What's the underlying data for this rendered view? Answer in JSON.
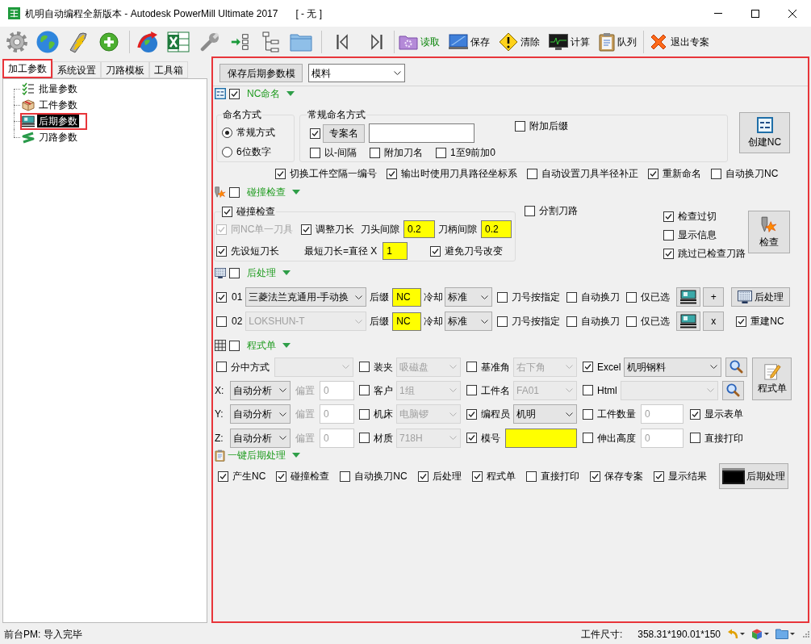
{
  "window": {
    "title": "机明自动编程全新版本 - Autodesk PowerMill Ultimate 2017",
    "document": "[ - 无 ]"
  },
  "toolbar": {
    "buttons": [
      {
        "label": "读取",
        "highlighted": true
      },
      {
        "label": "保存",
        "highlighted": false
      },
      {
        "label": "清除",
        "highlighted": false
      },
      {
        "label": "计算",
        "highlighted": false
      },
      {
        "label": "队列",
        "highlighted": false
      },
      {
        "label": "退出专案",
        "highlighted": false
      }
    ]
  },
  "left_tabs": [
    {
      "label": "加工参数",
      "selected": true,
      "highlighted": true
    },
    {
      "label": "系统设置",
      "selected": false,
      "highlighted": false
    },
    {
      "label": "刀路模板",
      "selected": false,
      "highlighted": false
    },
    {
      "label": "工具箱",
      "selected": false,
      "highlighted": false
    }
  ],
  "tree": [
    {
      "label": "批量参数",
      "selected": false,
      "highlighted": false
    },
    {
      "label": "工件参数",
      "selected": false,
      "highlighted": false
    },
    {
      "label": "后期参数",
      "selected": true,
      "highlighted": true
    },
    {
      "label": "刀路参数",
      "selected": false,
      "highlighted": false
    }
  ],
  "post_panel": {
    "highlighted": true,
    "template_button": "保存后期参数模",
    "template": "模料",
    "nc_naming": {
      "title": "NC命名",
      "checked": true,
      "expanded": true,
      "mode": {
        "title": "命名方式",
        "options": [
          {
            "label": "常规方式",
            "selected": true
          },
          {
            "label": "6位数字",
            "selected": false
          }
        ]
      },
      "regular": {
        "title": "常规命名方式",
        "project_name": {
          "checked": true,
          "button": "专案名"
        },
        "suffix": {
          "label": "附加后缀",
          "checked": false
        },
        "options": [
          {
            "label": "以-间隔",
            "checked": false
          },
          {
            "label": "附加刀名",
            "checked": false
          },
          {
            "label": "1至9前加0",
            "checked": false
          }
        ]
      },
      "create_button": "创建NC",
      "options": [
        {
          "label": "切换工件空隔一编号",
          "checked": true
        },
        {
          "label": "输出时使用刀具路径坐标系",
          "checked": true
        },
        {
          "label": "自动设置刀具半径补正",
          "checked": false
        },
        {
          "label": "重新命名",
          "checked": true
        },
        {
          "label": "自动换刀NC",
          "checked": false
        }
      ]
    },
    "collision": {
      "title": "碰撞检查",
      "checked": false,
      "expanded": true,
      "group": {
        "label": "碰撞检查",
        "checked": true,
        "same_tool": {
          "label": "同NC单一刀具",
          "checked": true,
          "disabled": true
        },
        "adjust_length": {
          "label": "调整刀长",
          "checked": true,
          "disabled": false
        },
        "tip_gap": {
          "label": "刀头间隙",
          "value": "0.2",
          "highlighted": true
        },
        "holder_gap": {
          "label": "刀柄间隙",
          "value": "0.2",
          "highlighted": true
        },
        "short_first": {
          "label": "先设短刀长",
          "checked": true,
          "disabled": false
        },
        "min_length": {
          "label": "最短刀长=直径 X",
          "value": "1",
          "highlighted": true
        },
        "keep_numbers": {
          "label": "避免刀号改变",
          "checked": true,
          "disabled": false
        }
      },
      "split": {
        "label": "分割刀路",
        "checked": false
      },
      "checks": [
        {
          "label": "检查过切",
          "checked": true
        },
        {
          "label": "显示信息",
          "checked": false
        },
        {
          "label": "跳过已检查刀路",
          "checked": true
        }
      ],
      "button": "检查"
    },
    "post": {
      "title": "后处理",
      "checked": false,
      "expanded": true,
      "rows": [
        {
          "checked": true,
          "number": "01",
          "post": "三菱法兰克通用-手动换",
          "suffix": {
            "label": "后缀",
            "value": "NC",
            "highlighted": true
          },
          "coolant": {
            "label": "冷却",
            "value": "标准"
          },
          "options": [
            {
              "label": "刀号按指定",
              "checked": false
            },
            {
              "label": "自动换刀",
              "checked": false
            },
            {
              "label": "仅已选",
              "checked": false
            }
          ],
          "small_button": "+"
        },
        {
          "checked": false,
          "number": "02",
          "post": "LOKSHUN-T",
          "suffix": {
            "label": "后缀",
            "value": "NC",
            "highlighted": true
          },
          "coolant": {
            "label": "冷却",
            "value": "标准"
          },
          "options": [
            {
              "label": "刀号按指定",
              "checked": false
            },
            {
              "label": "自动换刀",
              "checked": false
            },
            {
              "label": "仅已选",
              "checked": false
            }
          ],
          "small_button": "x"
        }
      ],
      "post_button": "后处理",
      "rebuild": {
        "label": "重建NC",
        "checked": true
      }
    },
    "sheet": {
      "title": "程式单",
      "checked": false,
      "expanded": true,
      "centering": {
        "label": "分中方式",
        "checked": false
      },
      "axes": [
        {
          "label": "X:",
          "mode": "自动分析",
          "offset": {
            "label": "偏置",
            "value": "0",
            "disabled": true
          }
        },
        {
          "label": "Y:",
          "mode": "自动分析",
          "offset": {
            "label": "偏置",
            "value": "0",
            "disabled": true
          }
        },
        {
          "label": "Z:",
          "mode": "自动分析",
          "offset": {
            "label": "偏置",
            "value": "0",
            "disabled": true
          }
        }
      ],
      "fields": [
        {
          "label": "装夹",
          "checked": false,
          "value": "吸磁盘"
        },
        {
          "label": "客户",
          "checked": false,
          "value": "1组"
        },
        {
          "label": "机床",
          "checked": false,
          "value": "电脑锣"
        },
        {
          "label": "材质",
          "checked": false,
          "value": "718H"
        }
      ],
      "info": [
        {
          "label": "基准角",
          "checked": false,
          "kind": "select",
          "value": "右下角"
        },
        {
          "label": "工件名",
          "checked": false,
          "kind": "select",
          "value": "FA01"
        },
        {
          "label": "编程员",
          "checked": true,
          "kind": "select",
          "value": "机明"
        },
        {
          "label": "模号",
          "checked": true,
          "kind": "input",
          "highlighted": true
        }
      ],
      "output": [
        {
          "label": "Excel",
          "checked": true,
          "kind": "select",
          "value": "机明钢料"
        },
        {
          "label": "Html",
          "checked": false,
          "kind": "select"
        },
        {
          "label": "工件数量",
          "checked": false,
          "kind": "input",
          "value": "0",
          "highlighted": false
        },
        {
          "label": "伸出高度",
          "checked": false,
          "kind": "input",
          "value": "0",
          "highlighted": false
        }
      ],
      "button": "程式单",
      "extras": [
        {
          "label": "显示表单",
          "checked": true
        },
        {
          "label": "直接打印",
          "checked": false
        }
      ]
    },
    "one_click": {
      "title": "一键后期处理",
      "expanded": true,
      "options": [
        {
          "label": "产生NC",
          "checked": true
        },
        {
          "label": "碰撞检查",
          "checked": true
        },
        {
          "label": "自动换刀NC",
          "checked": false
        },
        {
          "label": "后处理",
          "checked": true
        },
        {
          "label": "程式单",
          "checked": true
        },
        {
          "label": "直接打印",
          "checked": false
        },
        {
          "label": "保存专案",
          "checked": true
        },
        {
          "label": "显示结果",
          "checked": true
        }
      ],
      "button": "后期处理"
    }
  },
  "status_bar": {
    "message": "前台PM: 导入完毕",
    "size_label": "工件尺寸:",
    "size": "358.31*190.01*150"
  }
}
